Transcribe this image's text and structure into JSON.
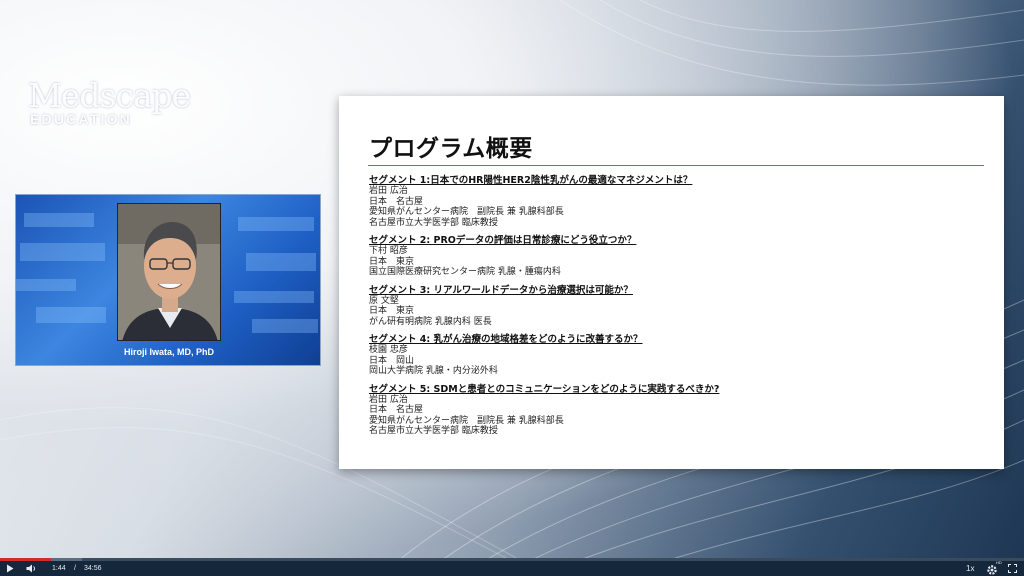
{
  "logo": {
    "main": "Medscape",
    "sub": "EDUCATION"
  },
  "video": {
    "speaker_name": "Hiroji Iwata, MD, PhD"
  },
  "slide": {
    "title": "プログラム概要",
    "segments": [
      {
        "title": "セグメント 1:日本でのHR陽性HER2陰性乳がんの最適なマネジメントは？",
        "lines": [
          "岩田 広治",
          "日本　名古屋",
          "愛知県がんセンター病院　副院長 兼 乳腺科部長",
          "名古屋市立大学医学部 臨床教授"
        ]
      },
      {
        "title": "セグメント 2: PROデータの評価は日常診療にどう役立つか？",
        "lines": [
          "下村 昭彦",
          "日本　東京",
          "国立国際医療研究センター病院 乳腺・腫瘍内科"
        ]
      },
      {
        "title": "セグメント 3: リアルワールドデータから治療選択は可能か？",
        "lines": [
          "原 文堅",
          "日本　東京",
          "がん研有明病院 乳腺内科 医長"
        ]
      },
      {
        "title": "セグメント 4: 乳がん治療の地域格差をどのように改善するか？",
        "lines": [
          "枝園 忠彦",
          "日本　岡山",
          "岡山大学病院 乳腺・内分泌外科"
        ]
      },
      {
        "title": "セグメント 5: SDMと患者とのコミュニケーションをどのように実践するべきか?",
        "lines": [
          "岩田 広治",
          "日本　名古屋",
          "愛知県がんセンター病院　副院長 兼 乳腺科部長",
          "名古屋市立大学医学部 臨床教授"
        ]
      }
    ]
  },
  "player": {
    "current_time": "1:44",
    "separator": "/",
    "duration": "34:56",
    "speed": "1x",
    "settings_badge": "HD",
    "played_fraction": 0.05,
    "buffered_fraction": 0.08,
    "colors": {
      "played": "#d12b2b",
      "bar": "#15273b"
    }
  }
}
